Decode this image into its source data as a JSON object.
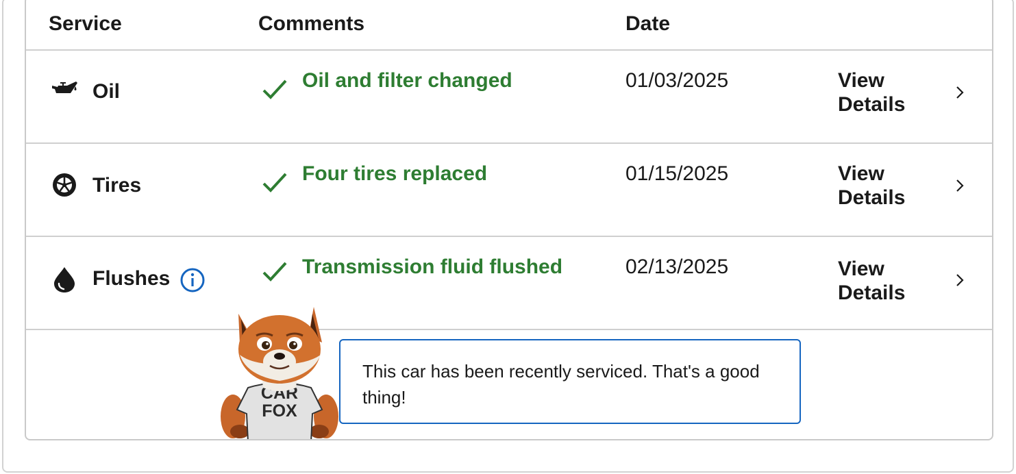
{
  "headers": {
    "service": "Service",
    "comments": "Comments",
    "date": "Date"
  },
  "rows": [
    {
      "service": "Oil",
      "icon": "oil-can-icon",
      "comment": "Oil and filter changed",
      "date": "01/03/2025",
      "action_line1": "View",
      "action_line2": "Details"
    },
    {
      "service": "Tires",
      "icon": "tire-icon",
      "comment": "Four tires replaced",
      "date": "01/15/2025",
      "action_line1": "View",
      "action_line2": "Details"
    },
    {
      "service": "Flushes",
      "icon": "drop-icon",
      "comment": "Transmission fluid flushed",
      "date": "02/13/2025",
      "action_line1": "View",
      "action_line2": "Details"
    }
  ],
  "mascot": {
    "shirt_line1": "CAR",
    "shirt_line2": "FOX"
  },
  "callout": {
    "text": "This car has been recently serviced. That's a good thing!"
  },
  "colors": {
    "success": "#2e7d32",
    "accent": "#1565c0",
    "border": "#cfcfcf"
  }
}
